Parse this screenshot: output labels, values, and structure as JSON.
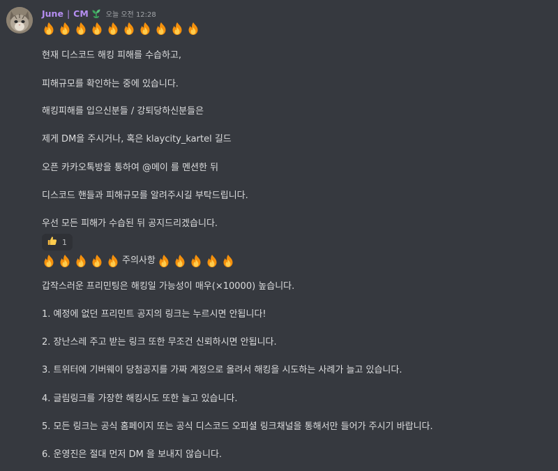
{
  "message": {
    "author": "June",
    "separator": "|",
    "role": "CM",
    "timestamp": "오늘 오전 12:28",
    "top_fire_count": 10,
    "lines": [
      "현재 디스코드 해킹 피해를 수습하고,",
      "피해규모를 확인하는 중에 있습니다.",
      "해킹피해를 입으신분들 / 강퇴당하신분들은",
      "제게 DM을 주시거나, 혹은 klaycity_kartel 길드",
      "오픈 카카오톡방을 통하여 @메이 를 멘션한 뒤",
      "디스코드 핸들과 피해규모를 알려주시길 부탁드립니다.",
      "우선 모든 피해가 수습된 뒤 공지드리겠습니다."
    ],
    "reaction": {
      "icon": "thumbs-up-icon",
      "count": "1"
    },
    "warning": {
      "label": "주의사항",
      "fire_before": 5,
      "fire_after": 5
    },
    "notes": [
      "갑작스러운 프리민팅은 해킹일 가능성이 매우(×10000) 높습니다.",
      "1. 예정에 없던 프리민트 공지의 링크는 누르시면 안됩니다!",
      "2. 장난스레 주고 받는 링크 또한 무조건 신뢰하시면 안됩니다.",
      "3. 트위터에 기버웨이 당첨공지를 가짜 계정으로 올려서 해킹을 시도하는 사례가 늘고 있습니다.",
      "4. 글림링크를 가장한 해킹시도 또한 늘고 있습니다.",
      "5. 모든 링크는 공식 홈페이지 또는 공식 디스코드 오피셜 링크채널을 통해서만 들어가 주시기 바랍니다.",
      "6. 운영진은 절대 먼저 DM 을 보내지 않습니다."
    ]
  },
  "colors": {
    "background": "#36393f",
    "username": "#b68ef2",
    "text": "#dcddde",
    "timestamp": "#a3a6aa",
    "reaction_bg": "#2f3136"
  }
}
